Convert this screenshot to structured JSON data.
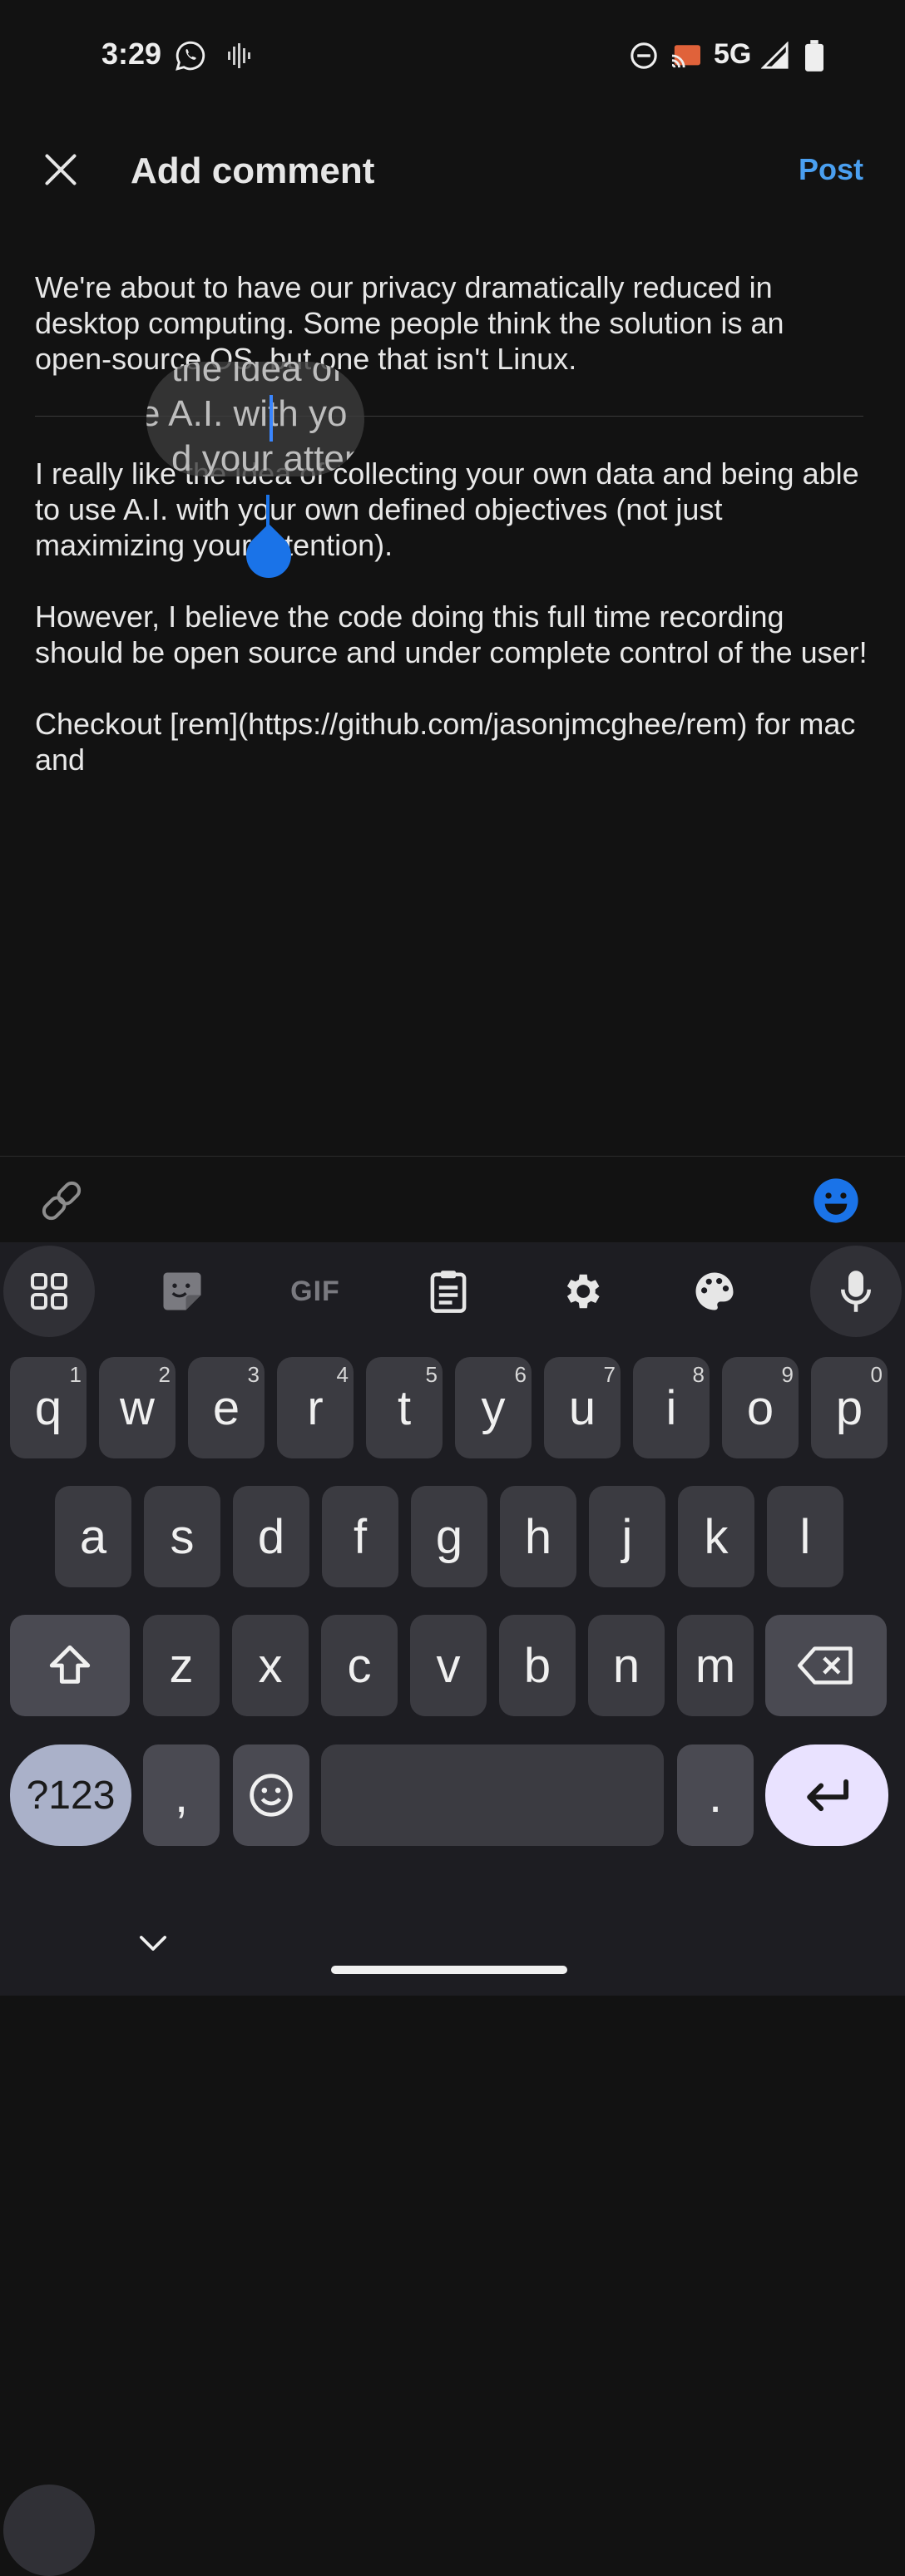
{
  "status_bar": {
    "time": "3:29",
    "network": "5G"
  },
  "header": {
    "title": "Add comment",
    "post_label": "Post"
  },
  "quote": {
    "text": "We're about to have our privacy dramatically reduced in desktop computing. Some people think the solution is an open-source OS, but one that isn't Linux."
  },
  "editor": {
    "value": "I really like the idea of collecting your own data and being able to use A.I. with your own defined objectives (not just maximizing your attention).\n\nHowever, I believe the code doing this full time recording should be open source and under complete control of the user!\n\nCheckout [rem](https://github.com/jasonjmcghee/rem) for mac and",
    "magnifier_lines": [
      "the idea of",
      "e A.I. with yo",
      "d your atten"
    ]
  },
  "keyboard": {
    "tools": [
      "apps-grid-icon",
      "sticker-icon",
      "gif-icon",
      "clipboard-icon",
      "settings-icon",
      "palette-icon",
      "mic-icon"
    ],
    "gif_label": "GIF",
    "row1": [
      {
        "k": "q",
        "h": "1"
      },
      {
        "k": "w",
        "h": "2"
      },
      {
        "k": "e",
        "h": "3"
      },
      {
        "k": "r",
        "h": "4"
      },
      {
        "k": "t",
        "h": "5"
      },
      {
        "k": "y",
        "h": "6"
      },
      {
        "k": "u",
        "h": "7"
      },
      {
        "k": "i",
        "h": "8"
      },
      {
        "k": "o",
        "h": "9"
      },
      {
        "k": "p",
        "h": "0"
      }
    ],
    "row2": [
      "a",
      "s",
      "d",
      "f",
      "g",
      "h",
      "j",
      "k",
      "l"
    ],
    "row3": [
      "z",
      "x",
      "c",
      "v",
      "b",
      "n",
      "m"
    ],
    "symbols_label": "?123",
    "comma_label": ",",
    "period_label": ".",
    "colors": {
      "accent": "#1a73e8",
      "post": "#4a9ff0",
      "enter_bg": "#e9e2ff",
      "symbols_bg": "#aab1c9"
    }
  }
}
